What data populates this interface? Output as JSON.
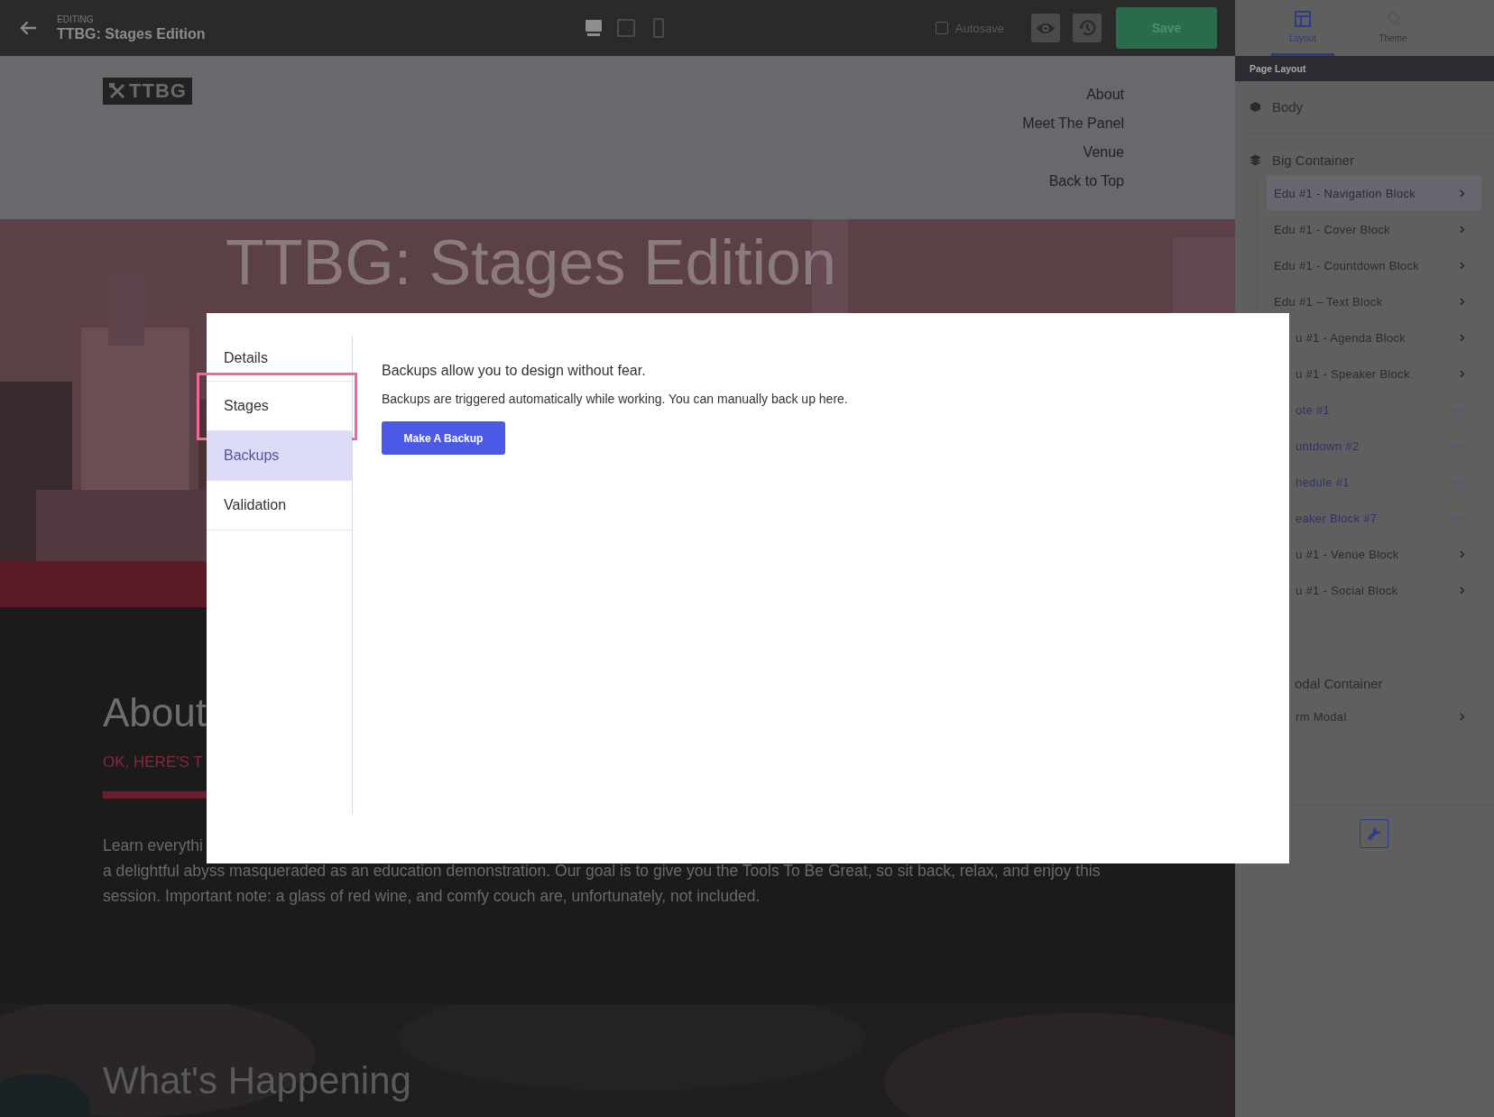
{
  "top_bar": {
    "eyebrow": "EDITING",
    "title": "TTBG: Stages Edition",
    "devices": [
      {
        "kind": "desktop",
        "selected": true
      },
      {
        "kind": "tablet",
        "selected": false
      },
      {
        "kind": "phone",
        "selected": false
      }
    ],
    "autosave": {
      "label": "Autosave",
      "checked": false
    },
    "save": "Save"
  },
  "site": {
    "logo": "TTBG",
    "nav_links": [
      "About",
      "Meet The Panel",
      "Venue",
      "Back to Top"
    ],
    "hero_title": "TTBG: Stages Edition",
    "about_heading": "About",
    "about_kicker": "OK, HERE'S T",
    "paragraph_lines": [
      "Learn everythi",
      "a delightful abyss masqueraded as an education demonstration. Our goal is to give you the Tools To Be Great, so sit back, relax, and enjoy this",
      "session. Important note: a glass of red wine, and comfy couch are, unfortunately, not included."
    ],
    "next_heading": "What's Happening"
  },
  "modal": {
    "tabs": [
      {
        "label": "Details",
        "selected": false,
        "highlighted": false
      },
      {
        "label": "Stages",
        "selected": false,
        "highlighted": true
      },
      {
        "label": "Backups",
        "selected": true,
        "highlighted": false
      },
      {
        "label": "Validation",
        "selected": false,
        "highlighted": false
      }
    ],
    "heading": "Backups allow you to design without fear.",
    "text": "Backups are triggered automatically while working. You can manually back up here.",
    "button": "Make A Backup"
  },
  "panel": {
    "tabs": [
      {
        "label": "Layout",
        "kind": "layout",
        "selected": true
      },
      {
        "label": "Theme",
        "kind": "theme",
        "selected": false
      }
    ],
    "section": "Page Layout",
    "groups": [
      {
        "label": "Body",
        "kind": "body",
        "covered": false
      },
      {
        "label": "Big Container",
        "kind": "stack",
        "covered": false,
        "items": [
          {
            "label": "Edu #1 - Navigation Block",
            "kind": "block",
            "selected": true,
            "covered": false
          },
          {
            "label": "Edu #1 - Cover Block",
            "kind": "block",
            "selected": false,
            "covered": false
          },
          {
            "label": "Edu #1 - Countdown Block",
            "kind": "block",
            "selected": false,
            "covered": false
          },
          {
            "label": "Edu #1 – Text Block",
            "kind": "block",
            "selected": false,
            "covered": false
          },
          {
            "label": "u #1 - Agenda Block",
            "kind": "block",
            "selected": false,
            "covered": true
          },
          {
            "label": "u #1 - Speaker Block",
            "kind": "block",
            "selected": false,
            "covered": true
          },
          {
            "label": "ote #1",
            "kind": "hidden",
            "selected": false,
            "covered": true
          },
          {
            "label": "untdown #2",
            "kind": "hidden",
            "selected": false,
            "covered": true
          },
          {
            "label": "hedule #1",
            "kind": "hidden",
            "selected": false,
            "covered": true
          },
          {
            "label": "eaker Block #7",
            "kind": "hidden",
            "selected": false,
            "covered": true
          },
          {
            "label": "u #1 - Venue Block",
            "kind": "block",
            "selected": false,
            "covered": true
          },
          {
            "label": "u #1 - Social Block",
            "kind": "block",
            "selected": false,
            "covered": true
          }
        ]
      },
      {
        "label": "odal Container",
        "kind": "stack",
        "covered": true,
        "items": [
          {
            "label": "rm Modal",
            "kind": "block",
            "selected": false,
            "covered": true
          }
        ]
      }
    ]
  }
}
